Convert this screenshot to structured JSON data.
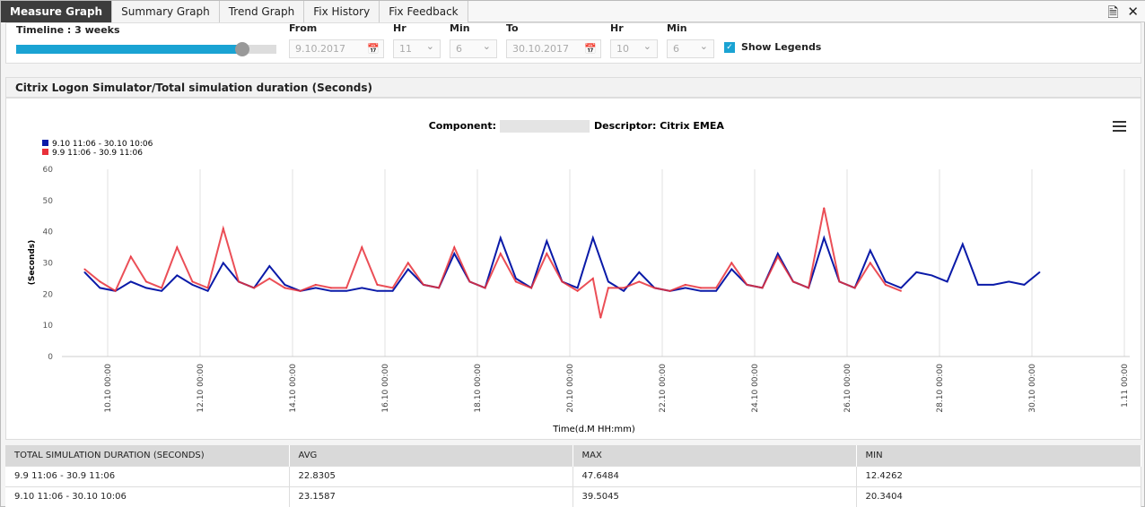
{
  "tabs": [
    "Measure Graph",
    "Summary Graph",
    "Trend Graph",
    "Fix History",
    "Fix Feedback"
  ],
  "active_tab": 0,
  "toolbar_icons": [
    "report-icon",
    "tools-icon"
  ],
  "controls": {
    "timeline_label": "Timeline : 3 weeks",
    "timeline_fraction": 0.87,
    "from_label": "From",
    "from_date": "9.10.2017",
    "hr_label": "Hr",
    "from_hr": "11",
    "min_label": "Min",
    "from_min": "6",
    "to_label": "To",
    "to_date": "30.10.2017",
    "to_hr": "10",
    "to_min": "6",
    "show_legends_label": "Show Legends",
    "show_legends": true
  },
  "panel_title": "Citrix Logon Simulator/Total simulation duration (Seconds)",
  "chart_data": {
    "type": "line",
    "title_component": "Component:",
    "title_descriptor": "Descriptor: Citrix EMEA",
    "ylabel": "(Seconds)",
    "xlabel": "Time(d.M HH:mm)",
    "ylim": [
      0,
      60
    ],
    "yticks": [
      "0",
      "10",
      "20",
      "30",
      "40",
      "50",
      "60"
    ],
    "xticks": [
      "10.10 00:00",
      "12.10 00:00",
      "14.10 00:00",
      "16.10 00:00",
      "18.10 00:00",
      "20.10 00:00",
      "22.10 00:00",
      "24.10 00:00",
      "26.10 00:00",
      "28.10 00:00",
      "30.10 00:00",
      "1.11 00:00"
    ],
    "grid": "vertical",
    "legend_position": "top-left",
    "series": [
      {
        "name": "9.10 11:06 - 30.10 10:06",
        "color": "#0a1aa8",
        "points": [
          [
            "9.10 12:00",
            27
          ],
          [
            "9.10 20:00",
            22
          ],
          [
            "10.10 04:00",
            21
          ],
          [
            "10.10 12:00",
            24
          ],
          [
            "10.10 20:00",
            22
          ],
          [
            "11.10 04:00",
            21
          ],
          [
            "11.10 12:00",
            26
          ],
          [
            "11.10 20:00",
            23
          ],
          [
            "12.10 04:00",
            21
          ],
          [
            "12.10 12:00",
            30
          ],
          [
            "12.10 20:00",
            24
          ],
          [
            "13.10 04:00",
            22
          ],
          [
            "13.10 12:00",
            29
          ],
          [
            "13.10 20:00",
            23
          ],
          [
            "14.10 04:00",
            21
          ],
          [
            "14.10 12:00",
            22
          ],
          [
            "14.10 20:00",
            21
          ],
          [
            "15.10 04:00",
            21
          ],
          [
            "15.10 12:00",
            22
          ],
          [
            "15.10 20:00",
            21
          ],
          [
            "16.10 04:00",
            21
          ],
          [
            "16.10 12:00",
            28
          ],
          [
            "16.10 20:00",
            23
          ],
          [
            "17.10 04:00",
            22
          ],
          [
            "17.10 12:00",
            33
          ],
          [
            "17.10 20:00",
            24
          ],
          [
            "18.10 04:00",
            22
          ],
          [
            "18.10 12:00",
            38
          ],
          [
            "18.10 20:00",
            25
          ],
          [
            "19.10 04:00",
            22
          ],
          [
            "19.10 12:00",
            37
          ],
          [
            "19.10 20:00",
            24
          ],
          [
            "20.10 04:00",
            22
          ],
          [
            "20.10 12:00",
            38
          ],
          [
            "20.10 20:00",
            24
          ],
          [
            "21.10 04:00",
            21
          ],
          [
            "21.10 12:00",
            27
          ],
          [
            "21.10 20:00",
            22
          ],
          [
            "22.10 04:00",
            21
          ],
          [
            "22.10 12:00",
            22
          ],
          [
            "22.10 20:00",
            21
          ],
          [
            "23.10 04:00",
            21
          ],
          [
            "23.10 12:00",
            28
          ],
          [
            "23.10 20:00",
            23
          ],
          [
            "24.10 04:00",
            22
          ],
          [
            "24.10 12:00",
            33
          ],
          [
            "24.10 20:00",
            24
          ],
          [
            "25.10 04:00",
            22
          ],
          [
            "25.10 12:00",
            38
          ],
          [
            "25.10 20:00",
            24
          ],
          [
            "26.10 04:00",
            22
          ],
          [
            "26.10 12:00",
            34
          ],
          [
            "26.10 20:00",
            24
          ],
          [
            "27.10 04:00",
            22
          ],
          [
            "27.10 12:00",
            27
          ],
          [
            "27.10 20:00",
            26
          ],
          [
            "28.10 04:00",
            24
          ],
          [
            "28.10 12:00",
            36
          ],
          [
            "28.10 20:00",
            23
          ],
          [
            "29.10 04:00",
            23
          ],
          [
            "29.10 12:00",
            24
          ],
          [
            "29.10 20:00",
            23
          ],
          [
            "30.10 04:00",
            27
          ]
        ]
      },
      {
        "name": "9.9 11:06 - 30.9 11:06",
        "color": "#e8303a",
        "points": [
          [
            "9.10 12:00",
            28
          ],
          [
            "9.10 20:00",
            24
          ],
          [
            "10.10 04:00",
            21
          ],
          [
            "10.10 12:00",
            32
          ],
          [
            "10.10 20:00",
            24
          ],
          [
            "11.10 04:00",
            22
          ],
          [
            "11.10 12:00",
            35
          ],
          [
            "11.10 20:00",
            24
          ],
          [
            "12.10 04:00",
            22
          ],
          [
            "12.10 12:00",
            41
          ],
          [
            "12.10 20:00",
            24
          ],
          [
            "13.10 04:00",
            22
          ],
          [
            "13.10 12:00",
            25
          ],
          [
            "13.10 20:00",
            22
          ],
          [
            "14.10 04:00",
            21
          ],
          [
            "14.10 12:00",
            23
          ],
          [
            "14.10 20:00",
            22
          ],
          [
            "15.10 04:00",
            22
          ],
          [
            "15.10 12:00",
            35
          ],
          [
            "15.10 20:00",
            23
          ],
          [
            "16.10 04:00",
            22
          ],
          [
            "16.10 12:00",
            30
          ],
          [
            "16.10 20:00",
            23
          ],
          [
            "17.10 04:00",
            22
          ],
          [
            "17.10 12:00",
            35
          ],
          [
            "17.10 20:00",
            24
          ],
          [
            "18.10 04:00",
            22
          ],
          [
            "18.10 12:00",
            33
          ],
          [
            "18.10 20:00",
            24
          ],
          [
            "19.10 04:00",
            22
          ],
          [
            "19.10 12:00",
            33
          ],
          [
            "19.10 20:00",
            24
          ],
          [
            "20.10 04:00",
            21
          ],
          [
            "20.10 12:00",
            25
          ],
          [
            "20.10 16:00",
            12.4
          ],
          [
            "20.10 20:00",
            22
          ],
          [
            "21.10 04:00",
            22
          ],
          [
            "21.10 12:00",
            24
          ],
          [
            "21.10 20:00",
            22
          ],
          [
            "22.10 04:00",
            21
          ],
          [
            "22.10 12:00",
            23
          ],
          [
            "22.10 20:00",
            22
          ],
          [
            "23.10 04:00",
            22
          ],
          [
            "23.10 12:00",
            30
          ],
          [
            "23.10 20:00",
            23
          ],
          [
            "24.10 04:00",
            22
          ],
          [
            "24.10 12:00",
            32
          ],
          [
            "24.10 20:00",
            24
          ],
          [
            "25.10 04:00",
            22
          ],
          [
            "25.10 12:00",
            47.6
          ],
          [
            "25.10 20:00",
            24
          ],
          [
            "26.10 04:00",
            22
          ],
          [
            "26.10 12:00",
            30
          ],
          [
            "26.10 20:00",
            23
          ],
          [
            "27.10 04:00",
            21
          ]
        ]
      }
    ]
  },
  "table": {
    "headers": [
      "TOTAL SIMULATION DURATION (SECONDS)",
      "AVG",
      "MAX",
      "MIN"
    ],
    "rows": [
      [
        "9.9 11:06 - 30.9 11:06",
        "22.8305",
        "47.6484",
        "12.4262"
      ],
      [
        "9.10 11:06 - 30.10 10:06",
        "23.1587",
        "39.5045",
        "20.3404"
      ]
    ]
  }
}
